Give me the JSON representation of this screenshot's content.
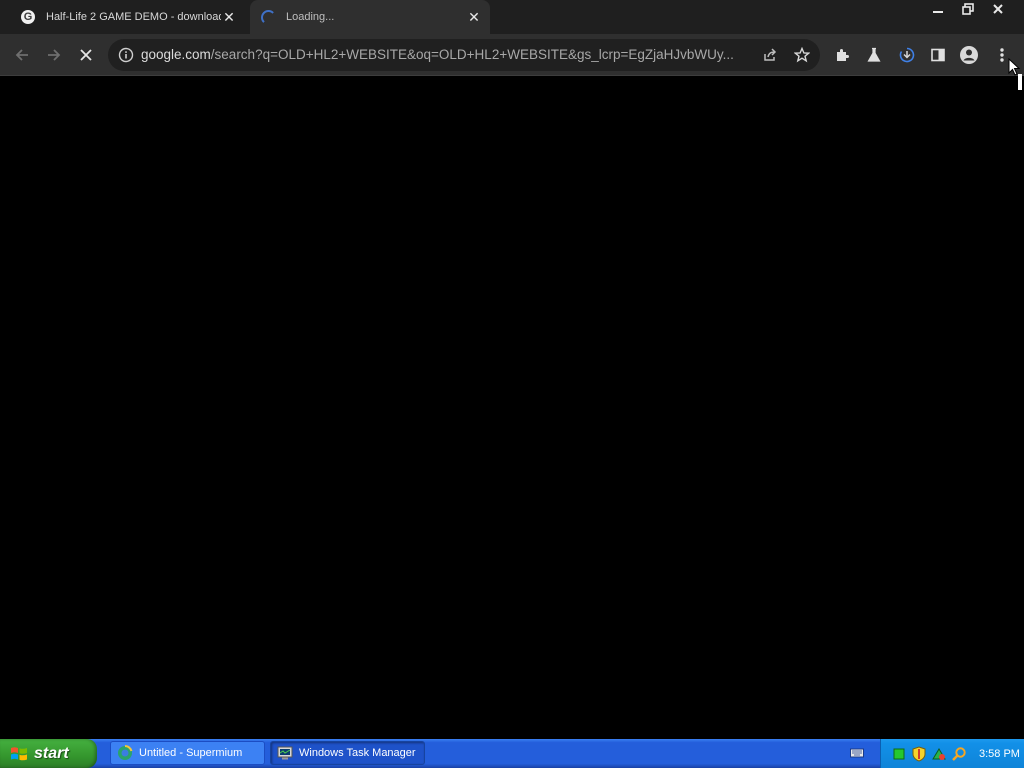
{
  "browser": {
    "tabs": [
      {
        "title": "Half-Life 2 GAME DEMO - download",
        "favicon": "google-favicon-icon",
        "favicon_letter": "G",
        "close": "✕"
      },
      {
        "title": "Loading...",
        "favicon": "loading-spinner-icon",
        "close": "✕"
      }
    ],
    "window_buttons": {
      "minimize": "minimize-icon",
      "restore": "restore-icon",
      "close": "close-icon"
    },
    "toolbar": {
      "back": "back-arrow-icon",
      "forward": "forward-arrow-icon",
      "stop": "stop-loading-icon",
      "url": "google.com/search?q=OLD+HL2+WEBSITE&oq=OLD+HL2+WEBSITE&gs_lcrp=EgZjaHJvbWUy...",
      "url_host": "google.com",
      "url_rest": "/search?q=OLD+HL2+WEBSITE&oq=OLD+HL2+WEBSITE&gs_lcrp=EgZjaHJvbWUy...",
      "icons": [
        "info-icon",
        "share-icon",
        "star-icon",
        "extensions-icon",
        "labs-icon",
        "download-icon",
        "side-panel-icon",
        "profile-icon",
        "menu-icon"
      ]
    },
    "content": "blank-black"
  },
  "taskbar": {
    "start_label": "start",
    "tasks": [
      {
        "label": "Untitled - Supermium",
        "icon": "supermium-icon",
        "active": false
      },
      {
        "label": "Windows Task Manager",
        "icon": "task-manager-icon",
        "active": true
      }
    ],
    "tray_icons": [
      "keyboard-icon",
      "green-square-icon",
      "security-shield-icon",
      "network-icon",
      "search-icon"
    ],
    "clock": "3:58 PM"
  },
  "colors": {
    "tabstrip": "#1f1f1f",
    "toolbar": "#2f2f2f",
    "omnibox": "#202020",
    "taskbar_blue": "#245edb",
    "start_green": "#34962d",
    "tray_blue": "#1290e8"
  }
}
